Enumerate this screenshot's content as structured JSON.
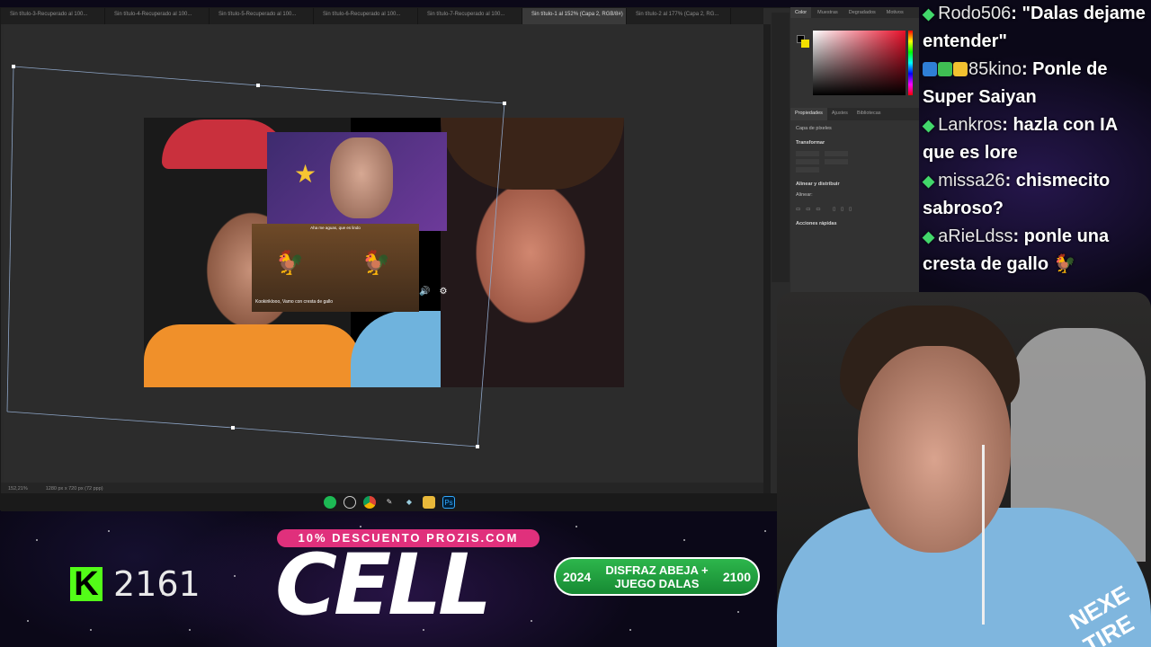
{
  "photoshop": {
    "tabs": [
      "Sin título-3-Recuperado al 100...",
      "Sin título-4-Recuperado al 100...",
      "Sin título-5-Recuperado al 100...",
      "Sin título-6-Recuperado al 100...",
      "Sin título-7-Recuperado al 100...",
      "Sin título-1 al 152% (Capa 2, RGB/8#)",
      "Sin título-2 al 177% (Capa 2, RG..."
    ],
    "active_tab": 5,
    "status": {
      "zoom": "152,21%",
      "doc_info": "1280 px x 720 px (72 ppp)"
    },
    "panel_tabs": [
      "Color",
      "Muestras",
      "Degradados",
      "Motivos"
    ],
    "props_tabs": [
      "Propiedades",
      "Ajustes",
      "Bibliotecas"
    ],
    "props": {
      "layer_type": "Capa de píxeles",
      "transform": "Transformar",
      "align": "Alinear y distribuir",
      "align_sub": "Alinear:",
      "quick_actions": "Acciones rápidas"
    },
    "thumbnail": {
      "clip_subtitle_top": "Aha me aguas, que es lindo",
      "clip_subtitle_bottom": "Kookiriklooo, Vamo con cresta de gallo"
    },
    "taskbar_icons": [
      "spotify-icon",
      "clock-icon",
      "chrome-icon",
      "edit-icon",
      "app-icon",
      "folder-icon",
      "photoshop-icon"
    ],
    "taskbar_ps_label": "Ps"
  },
  "chat": [
    {
      "user": "Rodo506",
      "text": ": \"Dalas dejame entender\"",
      "badges": []
    },
    {
      "user": "85kino",
      "text": ": Ponle de Super Saiyan",
      "badges": [
        "#2f7fd6",
        "#3fbf53",
        "#f2c230"
      ]
    },
    {
      "user": "Lankros",
      "text": ": hazla con IA que es lore",
      "badges": []
    },
    {
      "user": "missa26",
      "text": ": chismecito sabroso?",
      "badges": []
    },
    {
      "user": "aRieLdss",
      "text": ": ponle una cresta de gallo 🐓",
      "badges": []
    }
  ],
  "chat_colors": {
    "user": "#e6e6e6",
    "diamond": "#42d76b"
  },
  "kick": {
    "count": "2161",
    "logo": "K",
    "brand_color": "#53fc18"
  },
  "promo": {
    "text": "10% DESCUENTO PROZIS.COM",
    "color": "#e0307c"
  },
  "cell": {
    "text": "CELL"
  },
  "goal": {
    "start": "2024",
    "label_line1": "DISFRAZ ABEJA +",
    "label_line2": "JUEGO DALAS",
    "end": "2100",
    "color": "#2db64c"
  },
  "webcam": {
    "shirt_text": "NEXE TIRE"
  }
}
